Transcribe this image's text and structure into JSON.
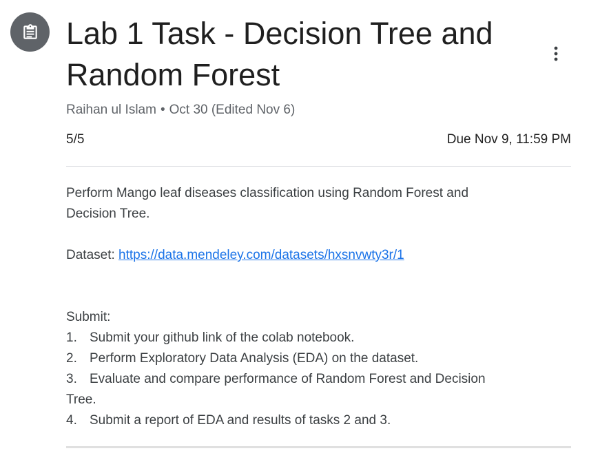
{
  "assignment": {
    "icon": "assignment-icon",
    "title": "Lab 1 Task - Decision Tree and Random Forest",
    "author": "Raihan ul Islam",
    "separator": "•",
    "posted": "Oct 30 (Edited Nov 6)",
    "points": "5/5",
    "due": "Due Nov 9, 11:59 PM",
    "more_icon": "more-vert-icon"
  },
  "description": {
    "intro_line1": "Perform  Mango leaf diseases classification using Random Forest and",
    "intro_line2": "Decision Tree.",
    "dataset_label": "Dataset: ",
    "dataset_link": "https://data.mendeley.com/datasets/hxsnvwty3r/1",
    "submit_heading": "Submit:",
    "items": [
      {
        "num": "1.",
        "text": "Submit your github link of the colab notebook."
      },
      {
        "num": "2.",
        "text": "Perform Exploratory Data Analysis (EDA) on the dataset."
      },
      {
        "num": "3.",
        "text": "Evaluate and compare performance of Random Forest and Decision",
        "text2": "Tree."
      },
      {
        "num": "4.",
        "text": "Submit a report of EDA and results of tasks 2 and 3."
      }
    ]
  },
  "colors": {
    "icon_bg": "#5f6368",
    "title": "#1f1f1f",
    "meta": "#5f6368",
    "link": "#1a73e8",
    "divider": "#dadce0"
  }
}
